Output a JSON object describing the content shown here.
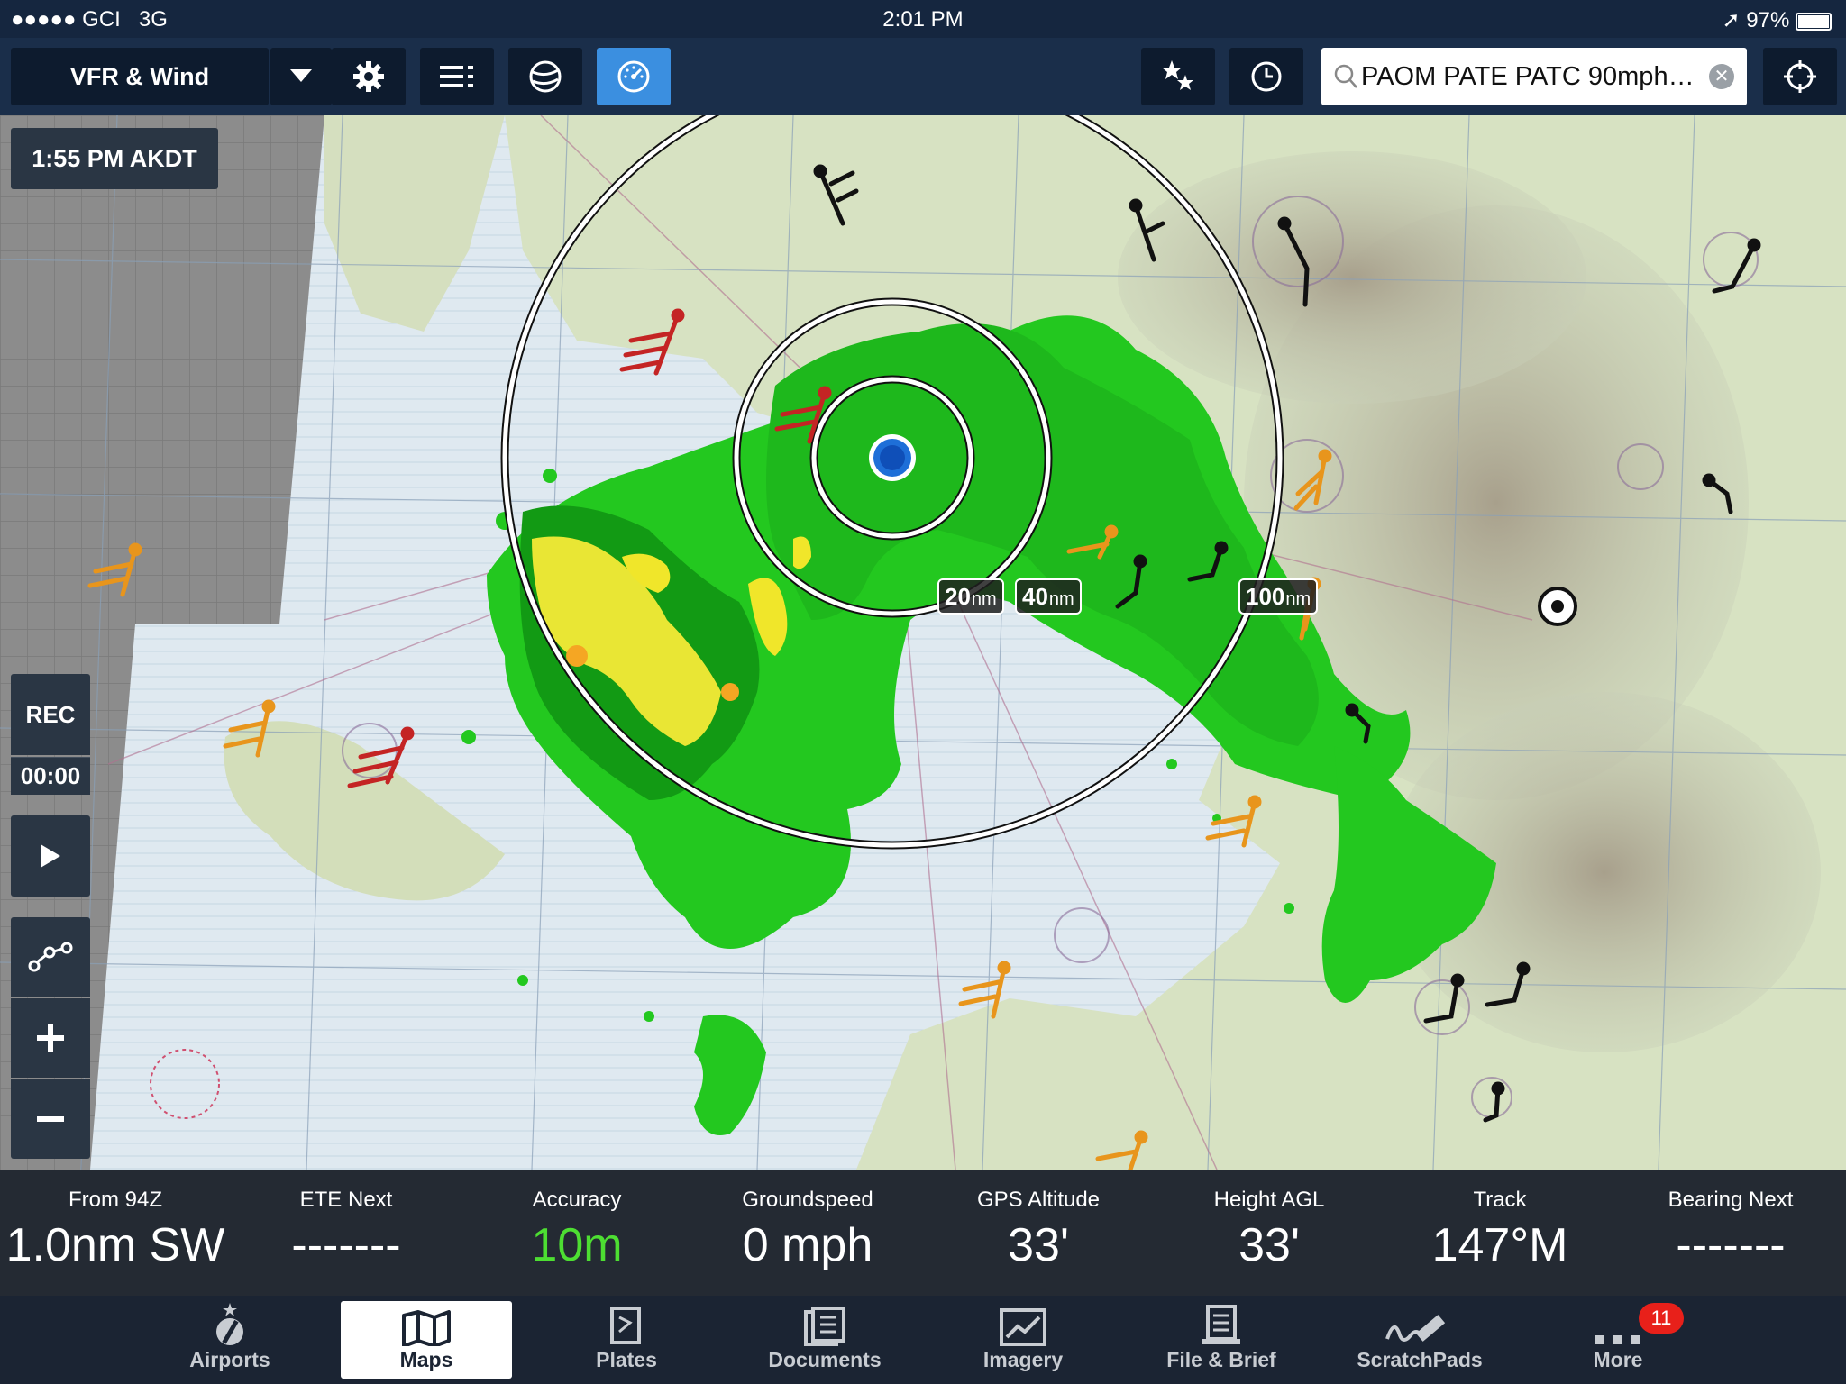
{
  "status_bar": {
    "carrier": "●●●●● GCI",
    "network": "3G",
    "time": "2:01 PM",
    "battery": "97%"
  },
  "toolbar": {
    "layer_label": "VFR & Wind",
    "search_value": "PAOM PATE PATC 90mph…"
  },
  "map": {
    "timestamp": "1:55 PM AKDT",
    "rings": [
      {
        "value": "20",
        "unit": "nm"
      },
      {
        "value": "40",
        "unit": "nm"
      },
      {
        "value": "100",
        "unit": "nm"
      }
    ]
  },
  "controls": {
    "rec_label": "REC",
    "rec_time": "00:00"
  },
  "instruments": [
    {
      "label": "From 94Z",
      "value": "1.0nm SW"
    },
    {
      "label": "ETE Next",
      "value": "-------"
    },
    {
      "label": "Accuracy",
      "value": "10m"
    },
    {
      "label": "Groundspeed",
      "value": "0 mph"
    },
    {
      "label": "GPS Altitude",
      "value": "33'"
    },
    {
      "label": "Height AGL",
      "value": "33'"
    },
    {
      "label": "Track",
      "value": "147°M"
    },
    {
      "label": "Bearing Next",
      "value": "-------"
    }
  ],
  "tabs": [
    {
      "label": "Airports"
    },
    {
      "label": "Maps"
    },
    {
      "label": "Plates"
    },
    {
      "label": "Documents"
    },
    {
      "label": "Imagery"
    },
    {
      "label": "File & Brief"
    },
    {
      "label": "ScratchPads"
    },
    {
      "label": "More",
      "badge": "11"
    }
  ],
  "colors": {
    "active_button": "#3b8fe0",
    "radar_green": "#22c81e",
    "radar_yellow": "#f0e62a",
    "accuracy_green": "#4dde32",
    "badge_red": "#e8201a"
  }
}
